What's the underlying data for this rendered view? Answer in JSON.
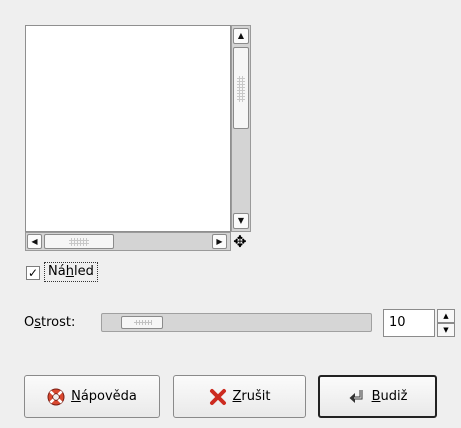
{
  "preview": {
    "checkbox_label_pre": "Ná",
    "checkbox_label_mnemonic": "h",
    "checkbox_label_post": "led",
    "checked": true
  },
  "sharpness": {
    "label_pre": "O",
    "label_mnemonic": "s",
    "label_post": "trost:",
    "value": "10"
  },
  "buttons": {
    "help_mnemonic": "N",
    "help_rest": "ápověda",
    "cancel_mnemonic": "Z",
    "cancel_rest": "rušit",
    "ok_mnemonic": "B",
    "ok_rest": "udiž"
  },
  "icons": {
    "help": "lifebuoy-icon",
    "cancel": "red-x-icon",
    "ok": "return-arrow-icon",
    "navigate": "four-way-arrow-icon"
  },
  "colors": {
    "cancel_icon": "#cc2a1f",
    "help_icon": "#d9482f"
  }
}
